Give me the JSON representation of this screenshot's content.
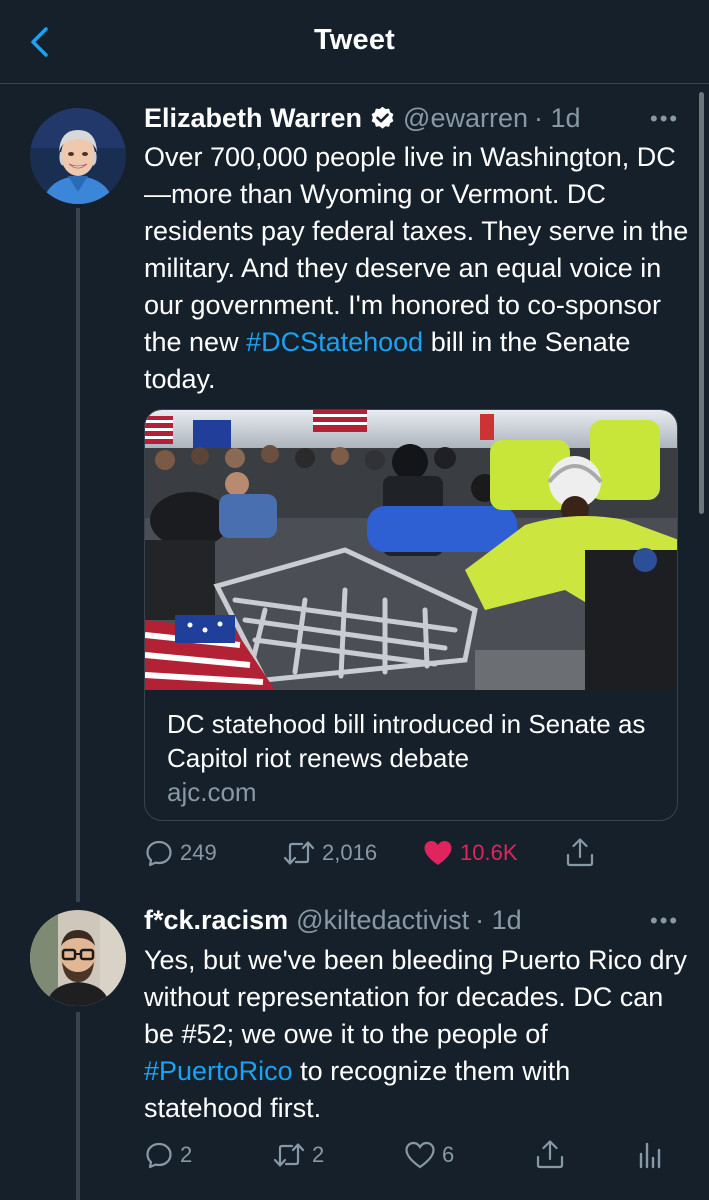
{
  "header": {
    "title": "Tweet"
  },
  "tweets": [
    {
      "name": "Elizabeth Warren",
      "verified": true,
      "handle": "@ewarren",
      "time": "· 1d",
      "text_before": "Over 700,000 people live in Washington, DC—more than Wyoming or Vermont. DC residents pay federal taxes. They serve in the military. And they deserve an equal voice in our government. I'm honored to co-sponsor the new ",
      "hashtag": "#DCStatehood",
      "text_after": " bill in the Senate today.",
      "card": {
        "title": "DC statehood bill introduced in Senate as Capitol riot renews debate",
        "domain": "ajc.com",
        "image": "photo of police officers in riot gear pushing against metal barricades held by protesters with flags"
      },
      "actions": {
        "replies": "249",
        "retweets": "2,016",
        "likes": "10.6K",
        "liked": true
      }
    },
    {
      "name": "f*ck.racism",
      "verified": false,
      "handle": "@kiltedactivist",
      "time": "· 1d",
      "text_before": "Yes, but we've been bleeding Puerto Rico dry without representation for decades. DC can be #52; we owe it to the people of ",
      "hashtag": "#PuertoRico",
      "text_after": " to recognize them with statehood first.",
      "actions": {
        "replies": "2",
        "retweets": "2",
        "likes": "6",
        "liked": false
      }
    }
  ],
  "icons": {
    "back": "chevron-left-icon",
    "more": "more-icon",
    "reply": "reply-icon",
    "retweet": "retweet-icon",
    "like": "heart-icon",
    "share": "share-icon",
    "analytics": "analytics-icon"
  },
  "colors": {
    "background": "#15202b",
    "accent": "#1da1f2",
    "secondary_text": "#8899a6",
    "like": "#e0245e",
    "divider": "#38444d"
  }
}
